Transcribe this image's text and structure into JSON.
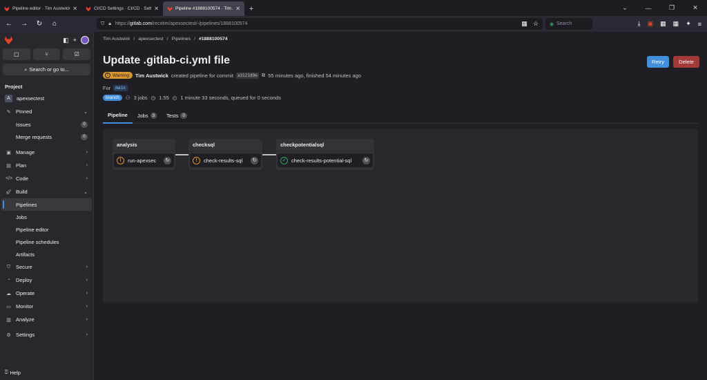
{
  "browser": {
    "tabs": [
      {
        "label": "Pipeline editor · Tim Austwick /",
        "active": false
      },
      {
        "label": "CI/CD Settings · CI/CD · Setting",
        "active": false
      },
      {
        "label": "Pipeline #1888100574 · Tim Au",
        "active": true
      }
    ],
    "url_prefix": "https://",
    "url_domain": "gitlab.com",
    "url_path": "/recxtim/apexsectest/-/pipelines/1888100574",
    "search_placeholder": "Search"
  },
  "sidebar": {
    "section_project": "Project",
    "project_avatar": "A",
    "project_name": "apexsectest",
    "search_label": "Search or go to...",
    "items": [
      {
        "label": "Pinned",
        "icon": "pin-icon"
      },
      {
        "label": "Issues",
        "count": "0"
      },
      {
        "label": "Merge requests",
        "count": "0"
      },
      {
        "label": "Manage"
      },
      {
        "label": "Plan"
      },
      {
        "label": "Code"
      },
      {
        "label": "Build"
      },
      {
        "label": "Pipelines"
      },
      {
        "label": "Jobs"
      },
      {
        "label": "Pipeline editor"
      },
      {
        "label": "Pipeline schedules"
      },
      {
        "label": "Artifacts"
      },
      {
        "label": "Secure"
      },
      {
        "label": "Deploy"
      },
      {
        "label": "Operate"
      },
      {
        "label": "Monitor"
      },
      {
        "label": "Analyze"
      },
      {
        "label": "Settings"
      }
    ],
    "help": "Help"
  },
  "breadcrumb": [
    "Tim Austwick",
    "apexsectest",
    "Pipelines",
    "#1888100574"
  ],
  "page": {
    "title": "Update .gitlab-ci.yml file",
    "retry": "Retry",
    "delete": "Delete",
    "status_badge": "Warning",
    "author": "Tim Austwick",
    "created_text": "created pipeline for commit",
    "sha": "a3121d9e",
    "time_text": "55 minutes ago, finished 54 minutes ago",
    "for_label": "For",
    "ref": "main",
    "branch_badge": "branch",
    "jobs_count": "3 jobs",
    "compute": "1.55",
    "duration": "1 minute 33 seconds, queued for 0 seconds"
  },
  "tabs": [
    {
      "label": "Pipeline"
    },
    {
      "label": "Jobs",
      "count": "3"
    },
    {
      "label": "Tests",
      "count": "0"
    }
  ],
  "stages": [
    {
      "name": "analysis",
      "job": "run-apexsec",
      "status": "warning"
    },
    {
      "name": "checksql",
      "job": "check-results-sql",
      "status": "warning"
    },
    {
      "name": "checkpotentialsql",
      "job": "check-results-potential-sql",
      "status": "success"
    }
  ],
  "colors": {
    "accent": "#428fdc",
    "warning": "#d99530",
    "success": "#2da160",
    "danger": "#a13a38"
  }
}
